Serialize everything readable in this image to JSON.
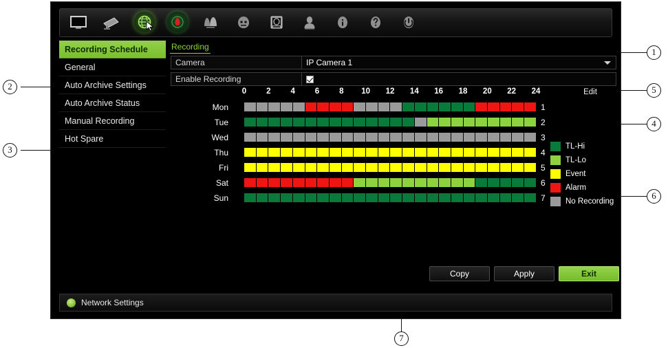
{
  "window": {
    "title": "Recording Schedule"
  },
  "toolbar": {
    "icons": [
      {
        "name": "display-monitor-icon",
        "label": "Display"
      },
      {
        "name": "camera-icon",
        "label": "Camera"
      },
      {
        "name": "network-globe-icon",
        "label": "Network",
        "active": true
      },
      {
        "name": "record-icon",
        "label": "Recording",
        "active": true
      },
      {
        "name": "alarm-bells-icon",
        "label": "Alarm"
      },
      {
        "name": "device-icon",
        "label": "Device"
      },
      {
        "name": "storage-disk-icon",
        "label": "Storage"
      },
      {
        "name": "user-icon",
        "label": "User"
      },
      {
        "name": "info-icon",
        "label": "System Info"
      },
      {
        "name": "help-icon",
        "label": "Help"
      },
      {
        "name": "power-icon",
        "label": "Shutdown"
      }
    ]
  },
  "sidebar": {
    "items": [
      {
        "label": "Recording Schedule",
        "selected": true
      },
      {
        "label": "General",
        "selected": false
      },
      {
        "label": "Auto Archive Settings",
        "selected": false
      },
      {
        "label": "Auto Archive Status",
        "selected": false
      },
      {
        "label": "Manual Recording",
        "selected": false
      },
      {
        "label": "Hot Spare",
        "selected": false
      }
    ]
  },
  "content": {
    "tab_label": "Recording",
    "camera_label": "Camera",
    "camera_value": "IP Camera 1",
    "enable_label": "Enable Recording",
    "enable_checked": true,
    "edit_label": "Edit"
  },
  "schedule": {
    "hour_ticks": [
      "0",
      "2",
      "4",
      "6",
      "8",
      "10",
      "12",
      "14",
      "16",
      "18",
      "20",
      "22",
      "24"
    ],
    "rows": [
      {
        "day": "Mon",
        "num": "1",
        "cells": [
          "gray",
          "gray",
          "gray",
          "gray",
          "gray",
          "red",
          "red",
          "red",
          "red",
          "gray",
          "gray",
          "gray",
          "gray",
          "green",
          "green",
          "green",
          "green",
          "green",
          "green",
          "red",
          "red",
          "red",
          "red",
          "red"
        ]
      },
      {
        "day": "Tue",
        "num": "2",
        "cells": [
          "green",
          "green",
          "green",
          "green",
          "green",
          "green",
          "green",
          "green",
          "green",
          "green",
          "green",
          "green",
          "green",
          "green",
          "gray",
          "lime",
          "lime",
          "lime",
          "lime",
          "lime",
          "lime",
          "lime",
          "lime",
          "lime"
        ]
      },
      {
        "day": "Wed",
        "num": "3",
        "cells": [
          "gray",
          "gray",
          "gray",
          "gray",
          "gray",
          "gray",
          "gray",
          "gray",
          "gray",
          "gray",
          "gray",
          "gray",
          "gray",
          "gray",
          "gray",
          "gray",
          "gray",
          "gray",
          "gray",
          "gray",
          "gray",
          "gray",
          "gray",
          "gray"
        ]
      },
      {
        "day": "Thu",
        "num": "4",
        "cells": [
          "yellow",
          "yellow",
          "yellow",
          "yellow",
          "yellow",
          "yellow",
          "yellow",
          "yellow",
          "yellow",
          "yellow",
          "yellow",
          "yellow",
          "yellow",
          "yellow",
          "yellow",
          "yellow",
          "yellow",
          "yellow",
          "yellow",
          "yellow",
          "yellow",
          "yellow",
          "yellow",
          "yellow"
        ]
      },
      {
        "day": "Fri",
        "num": "5",
        "cells": [
          "yellow",
          "yellow",
          "yellow",
          "yellow",
          "yellow",
          "yellow",
          "yellow",
          "yellow",
          "yellow",
          "yellow",
          "yellow",
          "yellow",
          "yellow",
          "yellow",
          "yellow",
          "yellow",
          "yellow",
          "yellow",
          "yellow",
          "yellow",
          "yellow",
          "yellow",
          "yellow",
          "yellow"
        ]
      },
      {
        "day": "Sat",
        "num": "6",
        "cells": [
          "red",
          "red",
          "red",
          "red",
          "red",
          "red",
          "red",
          "red",
          "red",
          "lime",
          "lime",
          "lime",
          "lime",
          "lime",
          "lime",
          "lime",
          "lime",
          "lime",
          "lime",
          "green",
          "green",
          "green",
          "green",
          "green"
        ]
      },
      {
        "day": "Sun",
        "num": "7",
        "cells": [
          "green",
          "green",
          "green",
          "green",
          "green",
          "green",
          "green",
          "green",
          "green",
          "green",
          "green",
          "green",
          "green",
          "green",
          "green",
          "green",
          "green",
          "green",
          "green",
          "green",
          "green",
          "green",
          "green",
          "green"
        ]
      }
    ]
  },
  "legend": {
    "items": [
      {
        "label": "TL-Hi",
        "color": "#0a7a3a",
        "key": "green"
      },
      {
        "label": "TL-Lo",
        "color": "#8dd340",
        "key": "lime"
      },
      {
        "label": "Event",
        "color": "#ffff00",
        "key": "yellow"
      },
      {
        "label": "Alarm",
        "color": "#ee1512",
        "key": "red"
      },
      {
        "label": "No Recording",
        "color": "#9a9a9a",
        "key": "gray"
      }
    ]
  },
  "buttons": {
    "copy": "Copy",
    "apply": "Apply",
    "exit": "Exit"
  },
  "statusbar": {
    "text": "Network Settings"
  },
  "callouts": [
    {
      "id": "1",
      "label": "1"
    },
    {
      "id": "2",
      "label": "2"
    },
    {
      "id": "3",
      "label": "3"
    },
    {
      "id": "4",
      "label": "4"
    },
    {
      "id": "5",
      "label": "5"
    },
    {
      "id": "6",
      "label": "6"
    },
    {
      "id": "7",
      "label": "7"
    }
  ],
  "colors": {
    "green": "#0a7a3a",
    "lime": "#8dd340",
    "yellow": "#ffff00",
    "red": "#ee1512",
    "gray": "#9a9a9a",
    "accent": "#8fd13f"
  }
}
